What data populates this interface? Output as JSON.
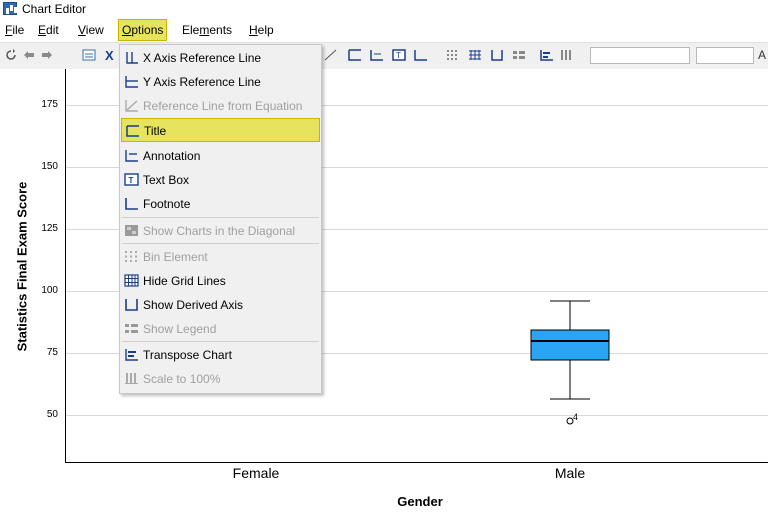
{
  "window": {
    "title": "Chart Editor"
  },
  "menubar": [
    {
      "label": "File",
      "u": "F",
      "rest": "ile"
    },
    {
      "label": "Edit",
      "u": "E",
      "rest": "dit"
    },
    {
      "label": "View",
      "u": "V",
      "rest": "iew"
    },
    {
      "label": "Options",
      "u": "O",
      "rest": "ptions"
    },
    {
      "label": "Elements",
      "pre": "Ele",
      "u": "m",
      "rest": "ents"
    },
    {
      "label": "Help",
      "u": "H",
      "rest": "elp"
    }
  ],
  "options_menu": [
    {
      "label": "X Axis Reference Line",
      "enabled": true,
      "icon": "x-axis-reference-line-icon"
    },
    {
      "label": "Y Axis Reference Line",
      "enabled": true,
      "icon": "y-axis-reference-line-icon"
    },
    {
      "label": "Reference Line from Equation",
      "enabled": false,
      "icon": "reference-line-equation-icon"
    },
    {
      "label": "Title",
      "enabled": true,
      "highlighted": true,
      "icon": "title-icon"
    },
    {
      "label": "Annotation",
      "enabled": true,
      "icon": "annotation-icon"
    },
    {
      "label": "Text Box",
      "enabled": true,
      "icon": "text-box-icon"
    },
    {
      "label": "Footnote",
      "enabled": true,
      "icon": "footnote-icon"
    },
    {
      "label": "Show Charts in the Diagonal",
      "enabled": false,
      "icon": "diagonal-charts-icon"
    },
    {
      "label": "Bin Element",
      "enabled": false,
      "icon": "bin-element-icon"
    },
    {
      "label": "Hide Grid Lines",
      "enabled": true,
      "icon": "grid-lines-icon"
    },
    {
      "label": "Show Derived Axis",
      "enabled": true,
      "icon": "derived-axis-icon"
    },
    {
      "label": "Show Legend",
      "enabled": false,
      "icon": "legend-icon"
    },
    {
      "label": "Transpose Chart",
      "enabled": true,
      "icon": "transpose-chart-icon"
    },
    {
      "label": "Scale to 100%",
      "enabled": false,
      "icon": "scale-100-icon"
    }
  ],
  "chart": {
    "ylabel": "Statistics Final Exam Score",
    "xlabel": "Gender",
    "yticks": [
      "175",
      "150",
      "125",
      "100",
      "75",
      "50"
    ],
    "categories": [
      "Female",
      "Male"
    ],
    "outlier_label": "4",
    "box_color": "#2aa4f4"
  },
  "chart_data": {
    "type": "box",
    "xlabel": "Gender",
    "ylabel": "Statistics Final Exam Score",
    "categories": [
      "Female",
      "Male"
    ],
    "yticks": [
      175,
      150,
      125,
      100,
      75,
      50
    ],
    "ylim": [
      30,
      185
    ],
    "boxes": [
      {
        "category": "Male",
        "min": 56,
        "q1": 72,
        "median": 79.5,
        "q3": 84,
        "max": 95,
        "outliers": [
          {
            "value": 47,
            "label": "4"
          }
        ]
      }
    ]
  }
}
